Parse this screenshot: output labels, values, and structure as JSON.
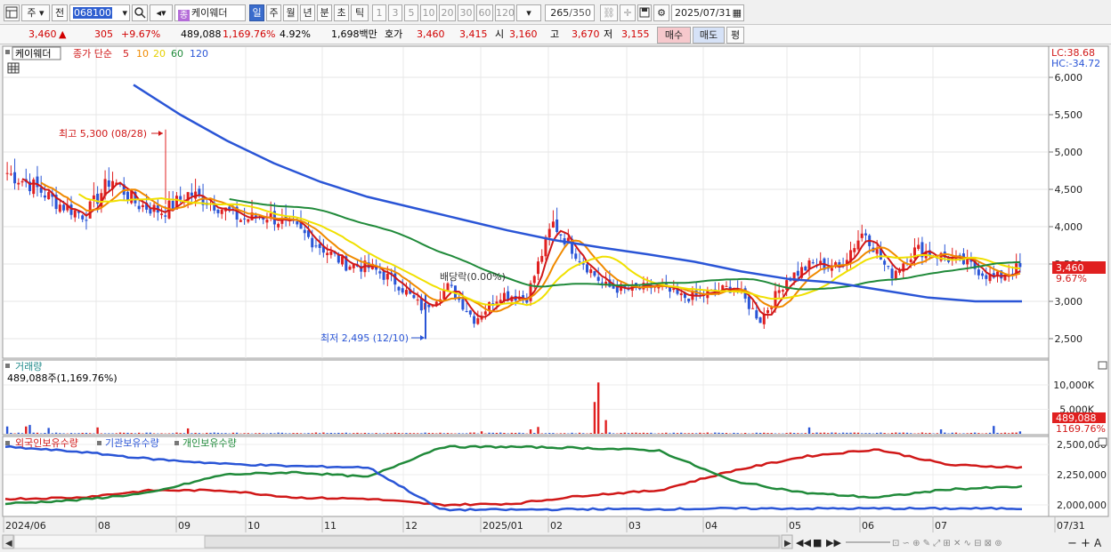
{
  "toolbar": {
    "market": "주",
    "market2": "전",
    "code": "068100",
    "stock_name": "케이웨더",
    "stock_icon": "종",
    "periods": [
      "일",
      "주",
      "월",
      "년",
      "분",
      "초",
      "틱"
    ],
    "selected_period": "일",
    "intervals": [
      "1",
      "3",
      "5",
      "10",
      "20",
      "30",
      "60",
      "120"
    ],
    "count": "265",
    "count_total": "/350",
    "date": "2025/07/31",
    "icons": [
      "layout-icon",
      "search-icon",
      "sound-icon",
      "link-icon",
      "crosshair-icon",
      "save-icon",
      "gear-icon",
      "calendar-icon"
    ]
  },
  "info": {
    "price": "3,460",
    "change": "305",
    "change_pct": "+9.67%",
    "volume": "489,088",
    "volume_pct": "1,169.76%",
    "turnover_pct": "4.92%",
    "amount": "1,698백만",
    "quote_label": "호가",
    "quote_ask": "3,460",
    "quote_bid": "3,415",
    "open_label": "시",
    "open": "3,160",
    "high_label": "고",
    "high": "3,670",
    "low_label": "저",
    "low": "3,155",
    "buy_label": "매수",
    "sell_label": "매도",
    "eval_label": "평"
  },
  "price_panel": {
    "stock_tag": "케이웨더",
    "ma_label": "종가 단순",
    "ma_periods": [
      "5",
      "10",
      "20",
      "60",
      "120"
    ],
    "ma_colors": [
      "#d01818",
      "#f08a00",
      "#f0e000",
      "#208a3a",
      "#2a55d6"
    ],
    "lc": "LC:38.68",
    "hc": "HC:-34.72",
    "current_tag": "3,460",
    "current_pct": "9.67%",
    "high_note": "최고 5,300 (08/28)",
    "low_note": "최저 2,495 (12/10)",
    "dividend_note": "배당락(0.00%)"
  },
  "volume_panel": {
    "title": "거래량",
    "subtitle": "489,088주(1,169.76%)",
    "tag_value": "489,088",
    "tag_pct": "1169.76%"
  },
  "holdings_panel": {
    "series_labels": [
      "외국인보유수량",
      "기관보유수량",
      "개인보유수량"
    ],
    "series_colors": [
      "#d01818",
      "#2a55d6",
      "#208a3a"
    ]
  },
  "chart_data": [
    {
      "type": "candlestick",
      "title": "케이웨더 일봉",
      "x_labels": [
        "2024/06",
        "08",
        "09",
        "10",
        "11",
        "12",
        "2025/01",
        "02",
        "03",
        "04",
        "05",
        "06",
        "07",
        "07/31"
      ],
      "y_ticks": [
        2500,
        3000,
        3500,
        4000,
        4500,
        5000,
        5500,
        6000
      ],
      "ylim": [
        2300,
        6200
      ],
      "series": [
        {
          "name": "종가",
          "values": [
            4720,
            4550,
            4300,
            4150,
            4650,
            4300,
            4200,
            4450,
            4300,
            4100,
            4150,
            4000,
            3750,
            3500,
            3450,
            3250,
            2900,
            3200,
            2750,
            3100,
            3050,
            4050,
            3600,
            3200,
            3150,
            3200,
            3050,
            3100,
            3200,
            2750,
            3300,
            3500,
            3450,
            3950,
            3350,
            3700,
            3600,
            3500,
            3300,
            3460
          ]
        },
        {
          "name": "MA120",
          "values": [
            null,
            null,
            null,
            null,
            5900,
            5500,
            5150,
            4850,
            4600,
            4400,
            4250,
            4100,
            3950,
            3820,
            3720,
            3630,
            3530,
            3400,
            3300,
            3250,
            3150,
            3050,
            3000,
            3000
          ]
        }
      ],
      "annotations": [
        "최고 5,300 (08/28)",
        "최저 2,495 (12/10)",
        "배당락(0.00%)"
      ]
    },
    {
      "type": "bar",
      "title": "거래량",
      "y_ticks": [
        "5,000K",
        "10,000K"
      ],
      "peak_values": [
        10500000,
        5000000,
        1500000,
        1200000
      ],
      "last_value": 489088
    },
    {
      "type": "line",
      "title": "보유수량",
      "y_ticks": [
        2000000,
        2250000,
        2500000
      ],
      "series": [
        {
          "name": "외국인보유수량",
          "values": [
            2050000,
            2060000,
            2120000,
            2120000,
            2060000,
            2050000,
            2000000,
            2010000,
            2080000,
            2120000,
            2280000,
            2400000,
            2460000,
            2330000,
            2310000
          ]
        },
        {
          "name": "기관보유수량",
          "values": [
            2480000,
            2440000,
            2380000,
            2340000,
            2320000,
            2310000,
            1960000,
            1960000,
            1965000,
            1965000,
            1970000,
            1970000,
            1970000,
            1970000,
            1970000
          ]
        },
        {
          "name": "개인보유수량",
          "values": [
            2010000,
            2040000,
            2100000,
            2250000,
            2270000,
            2230000,
            2480000,
            2480000,
            2470000,
            2450000,
            2200000,
            2100000,
            2060000,
            2130000,
            2150000
          ]
        }
      ]
    }
  ]
}
